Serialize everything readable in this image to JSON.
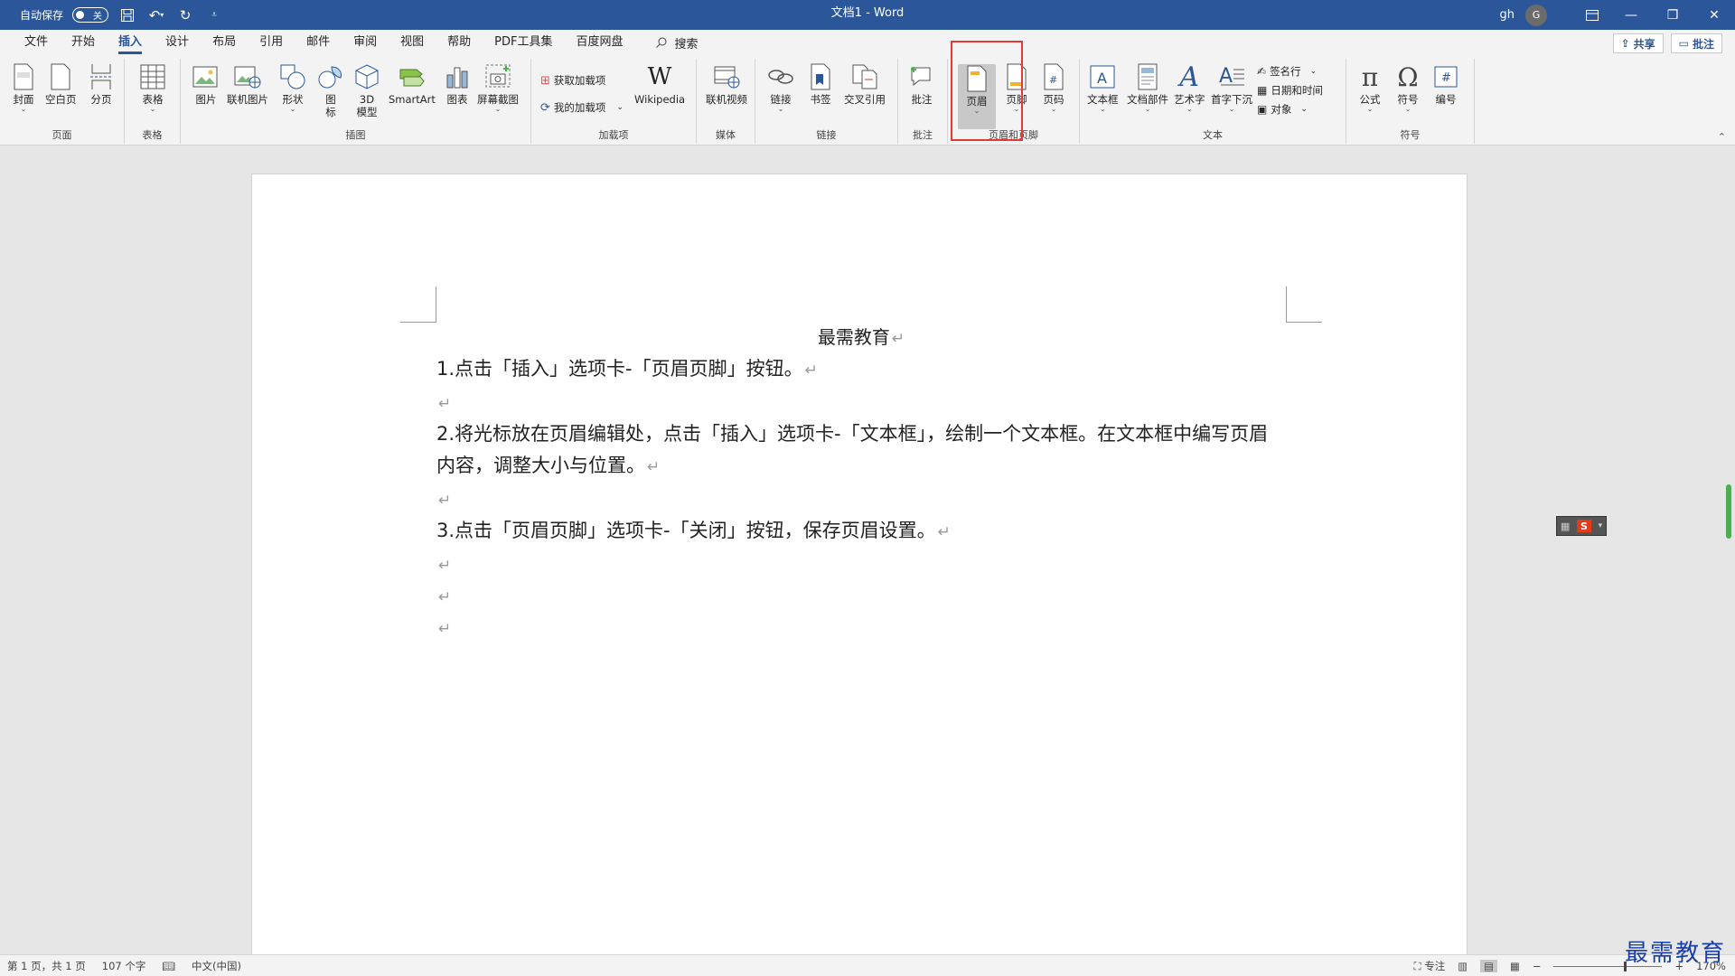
{
  "titlebar": {
    "autosave_label": "自动保存",
    "autosave_state": "关",
    "title": "文档1 - Word",
    "user": "gh",
    "avatar_letter": "G"
  },
  "menu": {
    "tabs": [
      "文件",
      "开始",
      "插入",
      "设计",
      "布局",
      "引用",
      "邮件",
      "审阅",
      "视图",
      "帮助",
      "PDF工具集",
      "百度网盘"
    ],
    "active_tab": "插入",
    "search": "搜索",
    "share": "共享",
    "comment": "批注"
  },
  "ribbon": {
    "groups": {
      "pages": "页面",
      "tables": "表格",
      "illustrations": "插图",
      "addins": "加载项",
      "media": "媒体",
      "links": "链接",
      "comments": "批注",
      "header_footer": "页眉和页脚",
      "text": "文本",
      "symbols": "符号"
    },
    "buttons": {
      "cover": "封面",
      "blank_page": "空白页",
      "page_break": "分页",
      "table": "表格",
      "picture": "图片",
      "online_picture": "联机图片",
      "shapes": "形状",
      "icons_1": "图",
      "icons_2": "标",
      "model_3d_1": "3D",
      "model_3d_2": "模型",
      "smartart": "SmartArt",
      "chart": "图表",
      "screenshot": "屏幕截图",
      "get_addins": "获取加载项",
      "my_addins": "我的加载项",
      "wikipedia": "Wikipedia",
      "online_video": "联机视频",
      "link": "链接",
      "bookmark": "书签",
      "cross_ref": "交叉引用",
      "comment": "批注",
      "header": "页眉",
      "footer": "页脚",
      "page_number": "页码",
      "text_box": "文本框",
      "quick_parts": "文档部件",
      "wordart": "艺术字",
      "drop_cap": "首字下沉",
      "signature_line": "签名行",
      "date_time": "日期和时间",
      "object": "对象",
      "equation": "公式",
      "symbol": "符号",
      "number": "编号"
    }
  },
  "document": {
    "header_text": "最需教育",
    "paragraphs": [
      "1.点击「插入」选项卡-「页眉页脚」按钮。",
      "",
      "2.将光标放在页眉编辑处，点击「插入」选项卡-「文本框」，绘制一个文本框。在文本框中编写页眉内容，调整大小与位置。",
      "",
      "3.点击「页眉页脚」选项卡-「关闭」按钮，保存页眉设置。",
      "",
      "",
      ""
    ],
    "para_mark": "↵"
  },
  "statusbar": {
    "page_info": "第 1 页，共 1 页",
    "word_count": "107 个字",
    "language": "中文(中国)",
    "focus": "专注",
    "zoom_minus": "−",
    "zoom_plus": "+",
    "zoom": "170%"
  },
  "watermark": "最需教育",
  "colors": {
    "titlebar": "#2b579a",
    "highlight": "#e53935",
    "accent": "#2b579a"
  }
}
